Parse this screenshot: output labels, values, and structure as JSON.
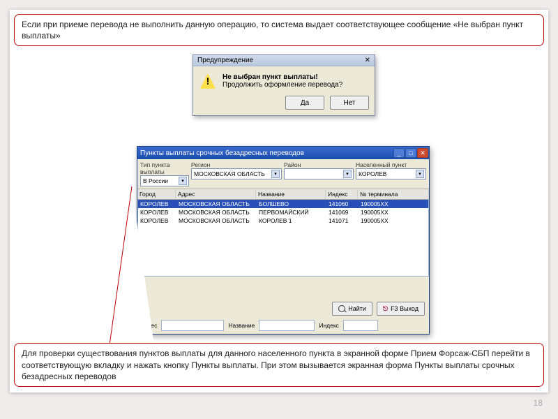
{
  "callouts": {
    "top": "Если при приеме перевода не выполнить данную операцию, то система выдает соответствующее сообщение «Не выбран пункт выплаты»",
    "bottom": "Для проверки существования пунктов выплаты для данного населенного пункта в экранной форме Прием Форсаж-СБП перейти в соответствующую вкладку и нажать кнопку Пункты выплаты. При этом вызывается экранная форма Пункты выплаты срочных безадресных переводов"
  },
  "warning_dialog": {
    "title": "Предупреждение",
    "line1": "Не выбран пункт выплаты!",
    "line2": "Продолжить оформление перевода?",
    "yes": "Да",
    "no": "Нет"
  },
  "main_window": {
    "title": "Пункты выплаты срочных безадресных переводов",
    "filters": {
      "type_label": "Тип пункта выплаты",
      "type_value": "В России",
      "region_label": "Регион",
      "region_value": "МОСКОВСКАЯ ОБЛАСТЬ",
      "district_label": "Район",
      "district_value": "",
      "settlement_label": "Населенный пункт",
      "settlement_value": "КОРОЛЕВ"
    },
    "columns": {
      "city": "Город",
      "address": "Адрес",
      "name": "Название",
      "index": "Индекс",
      "terminal_no": "№ терминала"
    },
    "rows": [
      {
        "city": "КОРОЛЕВ",
        "address": "МОСКОВСКАЯ ОБЛАСТЬ",
        "name": "БОЛШЕВО",
        "index": "141060",
        "terminal": "190005XX"
      },
      {
        "city": "КОРОЛЕВ",
        "address": "МОСКОВСКАЯ ОБЛАСТЬ",
        "name": "ПЕРВОМАЙСКИЙ",
        "index": "141069",
        "terminal": "190005XX"
      },
      {
        "city": "КОРОЛЕВ",
        "address": "МОСКОВСКАЯ ОБЛАСТЬ",
        "name": "КОРОЛЕВ 1",
        "index": "141071",
        "terminal": "190005XX"
      }
    ],
    "bottom": {
      "address_label": "Адрес",
      "name_label": "Название",
      "index_label": "Индекс",
      "find": "Найти",
      "exit": "F3 Выход"
    }
  },
  "page_number": "18"
}
